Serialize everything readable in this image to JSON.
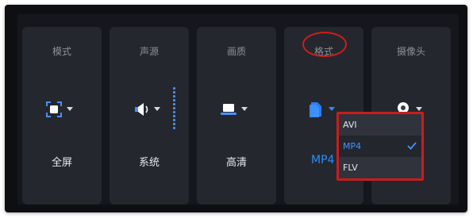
{
  "panel": {
    "cards": [
      {
        "title": "模式",
        "icon": "fullscreen-icon",
        "value": "全屏"
      },
      {
        "title": "声源",
        "icon": "speaker-icon",
        "value": "系统"
      },
      {
        "title": "画质",
        "icon": "laptop-icon",
        "value": "高清"
      },
      {
        "title": "格式",
        "icon": "file-icon",
        "value": "MP4"
      },
      {
        "title": "摄像头",
        "icon": "webcam-icon",
        "value": ""
      }
    ]
  },
  "format_dropdown": {
    "options": [
      "AVI",
      "MP4",
      "FLV"
    ],
    "selected": "MP4"
  },
  "colors": {
    "accent": "#2d8cff",
    "annotation": "#d01c1c",
    "card_bg": "#25272e",
    "panel_bg": "#16171c"
  }
}
